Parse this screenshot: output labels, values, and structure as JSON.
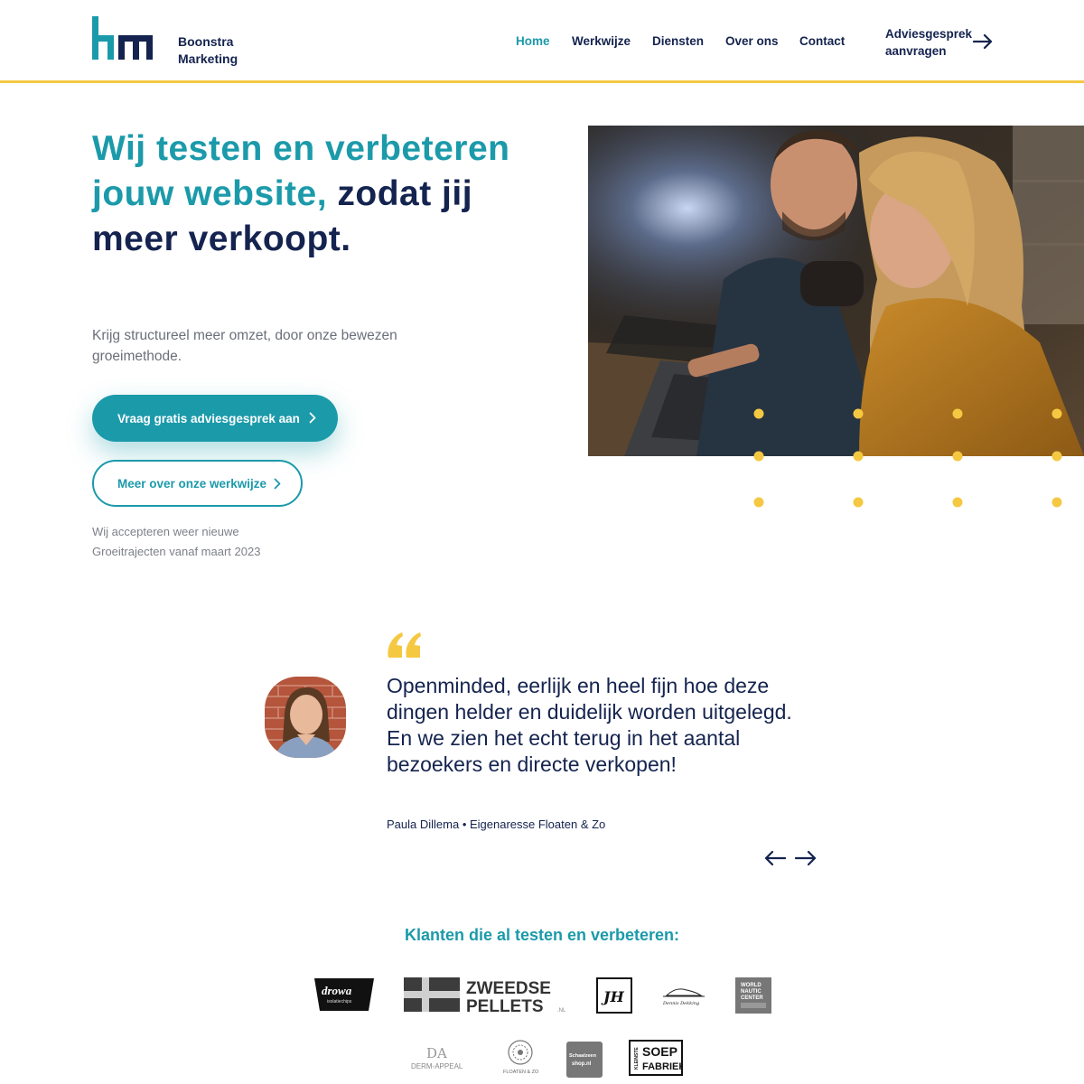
{
  "header": {
    "logo_text_line1": "Boonstra",
    "logo_text_line2": "Marketing",
    "nav": [
      {
        "label": "Home",
        "active": true
      },
      {
        "label": "Werkwijze",
        "active": false
      },
      {
        "label": "Diensten",
        "active": false
      },
      {
        "label": "Over ons",
        "active": false
      },
      {
        "label": "Contact",
        "active": false
      }
    ],
    "cta_line1": "Adviesgesprek",
    "cta_line2": "aanvragen"
  },
  "hero": {
    "title_teal": "Wij testen en verbeteren jouw website,",
    "title_navy": " zodat jij meer verkoopt.",
    "subtitle": "Krijg structureel meer omzet, door onze bewezen groeimethode.",
    "primary_button": "Vraag gratis adviesgesprek aan",
    "secondary_button": "Meer over onze werkwijze",
    "note_line1": "Wij accepteren weer nieuwe",
    "note_line2": "Groeitrajecten vanaf maart 2023"
  },
  "testimonial": {
    "quote": "Openminded, eerlijk en heel fijn hoe deze dingen helder en duidelijk worden uitgelegd. En we zien het echt terug in het aantal bezoekers en directe verkopen!",
    "author": "Paula Dillema • Eigenaresse Floaten & Zo"
  },
  "clients": {
    "title": "Klanten die al testen en verbeteren:",
    "logos": {
      "drowa": "drowa",
      "drowa_sub": "isolatiechips",
      "zweedse1": "ZWEEDSE",
      "zweedse2": "PELLETS",
      "zweedse_nl": ".NL",
      "jh": "JH",
      "dennis": "Dennis Dekking",
      "wnc1": "WORLD",
      "wnc2": "NAUTIC",
      "wnc3": "CENTER",
      "derm_mark": "DA",
      "derm": "DERM-APPEAL",
      "floaten": "FLOATEN & ZO",
      "schaal1": "Schaalzeen",
      "schaal2": "shop.nl",
      "soep1": "KLEINSTE",
      "soep2": "SOEP",
      "soep3": "FABRIEK"
    }
  },
  "colors": {
    "teal": "#1b9aaa",
    "navy": "#14234f",
    "yellow": "#f5c842"
  }
}
